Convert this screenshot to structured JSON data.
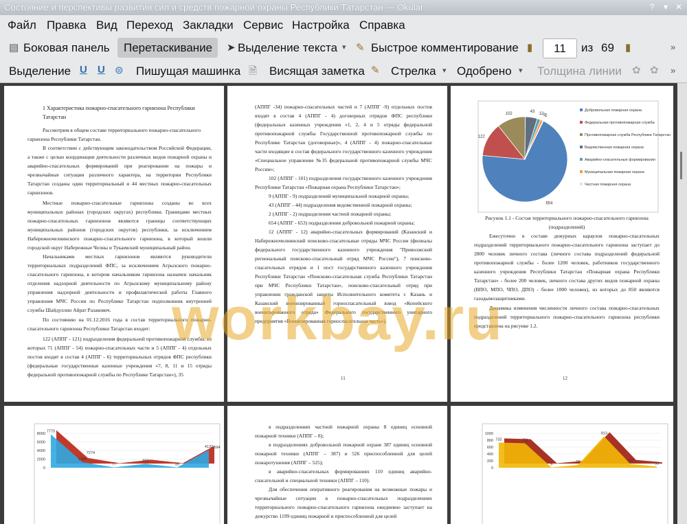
{
  "window": {
    "title": "Состояние и перспективы развития сил и средств пожарной охраны Республики Татарстан  — Okular"
  },
  "menu": [
    "Файл",
    "Правка",
    "Вид",
    "Переход",
    "Закладки",
    "Сервис",
    "Настройка",
    "Справка"
  ],
  "toolbar1": {
    "sidebar": "Боковая панель",
    "drag": "Перетаскивание",
    "text_select": "Выделение текста",
    "quick_comment": "Быстрое комментирование",
    "page_current": "11",
    "page_of": "из",
    "page_total": "69"
  },
  "toolbar2": {
    "highlight": "Выделение",
    "typewriter": "Пишущая машинка",
    "note": "Висящая заметка",
    "arrow": "Стрелка",
    "stamp": "Одобрено",
    "line_width": "Толщина линии"
  },
  "watermark": "workbay.ru",
  "page11": {
    "heading": "1  Характеристика  пожарно-спасательного  гарнизона Республики Татарстан",
    "p1": "Рассмотрим в общем составе территориального пожарно-спасательного гарнизона Республики Татарстан.",
    "p2": "В соответствии с действующим законодательством Российской Федерации, а также с целью координации деятельности различных видов пожарной охраны и аварийно-спасательных формирований при реагировании на пожары и чрезвычайные ситуации различного характера, на территории Республики Татарстан созданы один территориальный и 44 местных пожарно-спасательных гарнизонов.",
    "p3": "Местные пожарно-спасательные гарнизоны созданы во всех муниципальных районах (городских округах) республики. Границами местных пожарно-спасательных гарнизонов являются границы соответствующих муниципальных районов (городских округов) республики, за исключением Набережночелнинского пожарно-спасательного гарнизона, в который вошли городской округ Набережные Челны и Тукаевский муниципальный район.",
    "p4": "Начальниками местных гарнизонов являются руководители территориальных подразделений ФПС, за исключением Агрызского пожарно-спасательного гарнизона, в котором начальником гарнизона назначен начальник отделения надзорной деятельности по Агрызскому муниципальному району управления надзорной деятельности и профилактической работы Главного управления МЧС России по Республике Татарстан подполковник внутренней службы Шайдуллин Айрат Разакович.",
    "p5": "По состоянию на 01.12.2016 года в состав территориального пожарно-спасательного гарнизона Республики Татарстан входит:",
    "p6": "122 (АППГ - 121) подразделения федеральной противопожарной службы, из которых 71 (АППГ - 54) пожарно-спасательных части и 5 (АППГ - 4) отдельных постов входят в состав 4 (АППГ - 6) территориальных отрядов ФПС республики (федеральные государственные казенные учреждения «7, 8, 11 и 15 отряды федеральной противопожарной службы по Республике Татарстан»), 35",
    "num": "11"
  },
  "page12": {
    "p1": "(АППГ -34) пожарно-спасательных частей и 7 (АППГ -9) отдельных постов входят в состав 4 (АППГ - 4) договорных отрядов ФПС республики (федеральных казенных учреждения «1, 2, 4 и 5 отряды федеральной противопожарной службы Государственной противопожарной службы по Республике Татарстан (договорные)», 4 (АППГ - 4) пожарно-спасательные части входящие в состав федерального государственного казенного учреждения «Специальное управление №35 федеральной противопожарной службы МЧС России»;",
    "p2": "102 (АППГ - 101) подразделения государственного казенного учреждения Республики Татарстан «Пожарная охрана Республики Татарстан»;",
    "p3": "9 (АППГ - 9) подразделений муниципальной пожарной охраны;",
    "p4": "43 (АППГ - 44) подразделения ведомственной пожарной охраны;",
    "p5": "2 (АППГ - 2) подразделения частной пожарной охраны;",
    "p6": "654 (АППГ - 653) подразделения добровольной пожарной охраны;",
    "p7": "12 (АППГ - 12) аварийно-спасательных формирований (Казанский и Набережночелнинский поисково-спасательные отряды МЧС России (филиалы федерального государственного казенного учреждения \"Приволжский региональный поисково-спасательный отряд МЧС России\"), 7 поисково-спасательных отрядов и 1 пост государственного казенного учреждения Республики Татарстан «Поисково-спасательная служба Республики Татарстан при МЧС Республики Татарстан», поисково-спасательный отряд при управлении гражданской защиты Исполнительного комитета г. Казань и Казанский военизированный горноспасательный взвод «Копейского военизированного отряда» Федерального государственного унитарного предприятия «Военизированная горноспасательная часть»).",
    "num": "11"
  },
  "page13": {
    "caption1": "Рисунок 1.1 - Состав территориального пожарно-спасательного гарнизона",
    "caption2": "(подразделений)",
    "p1": "Ежесуточно в составе дежурных караулов пожарно-спасательных подразделений территориального пожарно-спасательного гарнизона заступает до 2800 человек личного состава (личного состава подразделений федеральной противопожарной службы - более 1200 человек, работников государственного казенного учреждения Республики Татарстан «Пожарная охрана Республики Татарстан» - более 200 человек, личного состава других видов пожарной охраны (ВПО, МПО, ЧПО, ДПО) - более 1000 человек), из которых до 850 являются газодымозащитниками.",
    "p2": "Динамика изменения численности личного состава пожарно-спасательных подразделений территориального пожарно-спасательного гарнизона республики представлена на рисунке 1.2.",
    "num": "12"
  },
  "page15": {
    "p1": "в подразделениях частной пожарной охраны 8 единиц основной пожарной техники (АППГ – 8);",
    "p2": "в подразделениях добровольной пожарной охране 387 единиц основной пожарной техники (АППГ – 387) и 526 приспособленной для целей пожаротушения (АППГ – 525);",
    "p3": "в аварийно-спасательных формированиях 110 единиц аварийно-спасательной и специальной техники (АППГ – 110).",
    "p4": "Для обеспечения оперативного реагирования на возможные пожары и чрезвычайные ситуации в пожарно-спасательных подразделениях территориального пожарно-спасательного гарнизона ежедневно заступает на дежурство 1199 единиц пожарной и приспособленной для целей"
  },
  "chart_data": [
    {
      "type": "pie",
      "categories": [
        "Добровольная пожарная охрана",
        "Федеральная противопожарная служба",
        "Противопожарная служба Республики Татарстан",
        "Ведомственная пожарная охрана",
        "Аварийно-спасательные формирования",
        "Муниципальная пожарная охрана",
        "Частная пожарная охрана"
      ],
      "values": [
        654,
        122,
        102,
        43,
        12,
        9,
        2
      ],
      "colors": [
        "#4f81bd",
        "#c0504d",
        "#9b8b5a",
        "#5f6f80",
        "#5fa0b0",
        "#f79646",
        "#dce6f2"
      ],
      "legend": "right"
    },
    {
      "type": "area",
      "values_label_front": [
        "7779",
        "1294",
        "77",
        "907",
        "85",
        "4132"
      ],
      "values_label_back": [
        "7274",
        "594"
      ],
      "ylim": [
        0,
        8000
      ],
      "yticks": [
        "8000",
        "6000",
        "4000",
        "2000",
        "0"
      ]
    },
    {
      "type": "area",
      "values_label_front": [
        "732",
        "711",
        "9",
        "77",
        "913",
        "107",
        "35"
      ],
      "ylim": [
        0,
        1000
      ],
      "yticks": [
        "1000",
        "800",
        "600",
        "400",
        "200",
        "0"
      ]
    }
  ]
}
